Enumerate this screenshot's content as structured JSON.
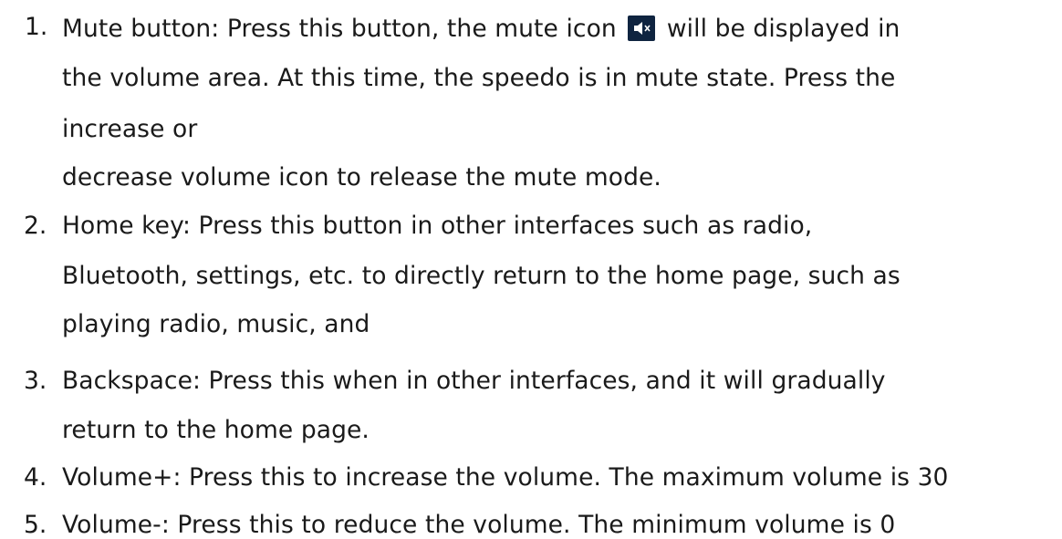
{
  "items": [
    {
      "number": "1.",
      "lines": [
        "Mute button: Press this button, the mute icon",
        "will be displayed in",
        "the volume area. At this time, the speedo is in mute state. Press the",
        "increase or",
        "decrease volume icon to release the mute mode."
      ],
      "icon": "speaker-muted-icon"
    },
    {
      "number": "2.",
      "lines": [
        "Home key: Press this button in other interfaces such as radio,",
        "Bluetooth, settings, etc. to directly return to the home page, such as",
        "playing radio, music, and"
      ]
    },
    {
      "number": "3.",
      "lines": [
        "Backspace: Press this when in other interfaces, and it will gradually",
        "return to the home page."
      ]
    },
    {
      "number": "4.",
      "lines": [
        "Volume+: Press this to increase the volume. The maximum volume is 30"
      ]
    },
    {
      "number": "5.",
      "lines": [
        "Volume-: Press this to reduce the volume. The minimum volume is 0"
      ]
    }
  ]
}
